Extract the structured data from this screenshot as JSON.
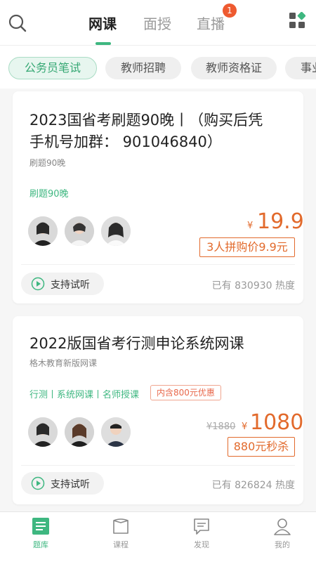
{
  "colors": {
    "accent": "#3eb780",
    "price": "#e26a2c",
    "badge": "#ee5a30"
  },
  "header": {
    "tabs": [
      {
        "label": "网课",
        "active": true
      },
      {
        "label": "面授",
        "active": false
      },
      {
        "label": "直播",
        "active": false
      }
    ],
    "badge_count": "1",
    "icons": {
      "search": "search-icon",
      "grid": "grid-icon"
    }
  },
  "categories": [
    "公务员笔试",
    "教师招聘",
    "教师资格证",
    "事业"
  ],
  "courses": [
    {
      "title_line1": "2023国省考刷题90晚丨（购买后凭",
      "title_line2": "手机号加群： 901046840）",
      "subtitle": "刷题90晚",
      "tags": "刷题90晚",
      "price_symbol": "¥",
      "price": "19.9",
      "deal": "3人拼购价9.9元",
      "trial_label": "支持试听",
      "heat": "已有 830930 热度"
    },
    {
      "title_line1": "2022版国省考行测申论系统网课",
      "subtitle": "格木教育新版网课",
      "tags": "行测丨系统网课丨名师授课",
      "promo": "内含800元优惠",
      "old_price": "¥1880",
      "price_symbol": "¥",
      "price": "1080",
      "deal": "880元秒杀",
      "trial_label": "支持试听",
      "heat": "已有 826824 热度"
    }
  ],
  "bottom_nav": [
    {
      "label": "题库",
      "icon": "question-bank-icon",
      "active": true
    },
    {
      "label": "课程",
      "icon": "course-icon",
      "active": false
    },
    {
      "label": "发现",
      "icon": "discover-icon",
      "active": false
    },
    {
      "label": "我的",
      "icon": "profile-icon",
      "active": false
    }
  ]
}
